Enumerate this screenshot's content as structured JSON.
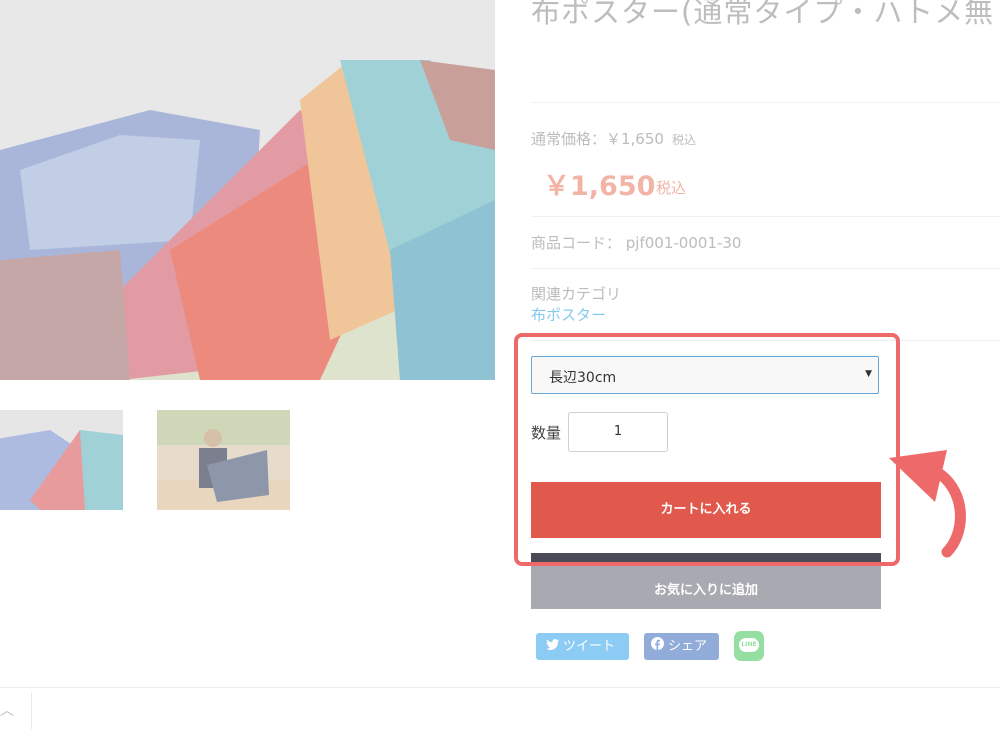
{
  "product": {
    "title": "布ポスター(通常タイプ・ハトメ無し)",
    "regular_price_label": "通常価格：￥1,650",
    "regular_price_tax": "税込",
    "sale_price": "￥1,650",
    "sale_price_tax": "税込",
    "product_code": "商品コード： pjf001-0001-30",
    "category_label": "関連カテゴリ",
    "category_link": "布ポスター"
  },
  "form": {
    "option_value": "長辺30cm",
    "quantity_label": "数量",
    "quantity_value": "1",
    "cart_button": "カートに入れる",
    "favorite_button": "お気に入りに追加"
  },
  "share": {
    "tweet": "ツイート",
    "facebook": "シェア",
    "line": "LINE"
  },
  "icons": {
    "twitter": "twitter-bird-icon",
    "facebook": "facebook-icon",
    "line": "line-icon",
    "select_arrow": "caret-down-icon",
    "scroll_top": "chevron-up-icon",
    "annotation": "curved-arrow-icon"
  },
  "colors": {
    "cart_button": "#e0594c",
    "favorite_button": "#a8a9b1",
    "highlight": "#ee6a6a",
    "sale_price": "#f1b4a6",
    "category_link": "#86c9ef"
  }
}
